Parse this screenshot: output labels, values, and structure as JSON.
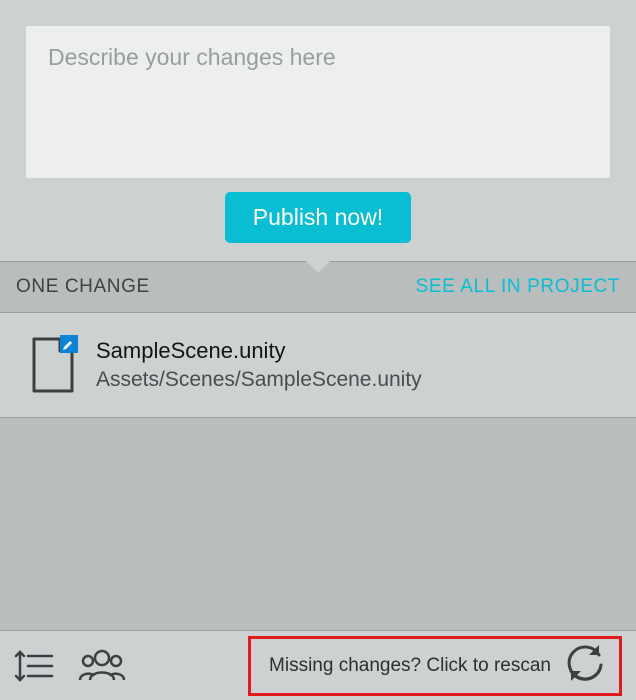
{
  "compose": {
    "placeholder": "Describe your changes here",
    "value": "",
    "publish_label": "Publish now!"
  },
  "changes": {
    "count_label": "ONE CHANGE",
    "see_all_label": "SEE ALL IN PROJECT",
    "items": [
      {
        "name": "SampleScene.unity",
        "path": "Assets/Scenes/SampleScene.unity",
        "status": "modified"
      }
    ]
  },
  "footer": {
    "rescan_label": "Missing changes? Click to rescan"
  },
  "colors": {
    "accent": "#09bdd3",
    "highlight_box": "#e11a1a"
  }
}
